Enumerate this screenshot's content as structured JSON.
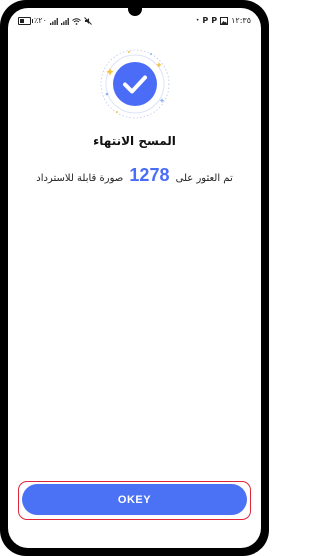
{
  "status_bar": {
    "left_text": "٪۲۰",
    "time": "١٢:٣٥",
    "icons_left": [
      "battery-icon",
      "signal-icon",
      "signal-icon",
      "wifi-icon",
      "mute-icon"
    ],
    "icons_right": [
      "p-icon",
      "p-icon",
      "gallery-icon",
      "notification-dot-icon"
    ],
    "p_label": "P"
  },
  "dialog": {
    "title": "المسح الانتهاء",
    "result_prefix": "تم العثور على",
    "count": "1278",
    "result_suffix": "صورة قابلة للاسترداد",
    "accent_color": "#4a6cf7"
  },
  "actions": {
    "okey_label": "OKEY",
    "button_color": "#4b72f5",
    "highlight_color": "#e2263a"
  }
}
